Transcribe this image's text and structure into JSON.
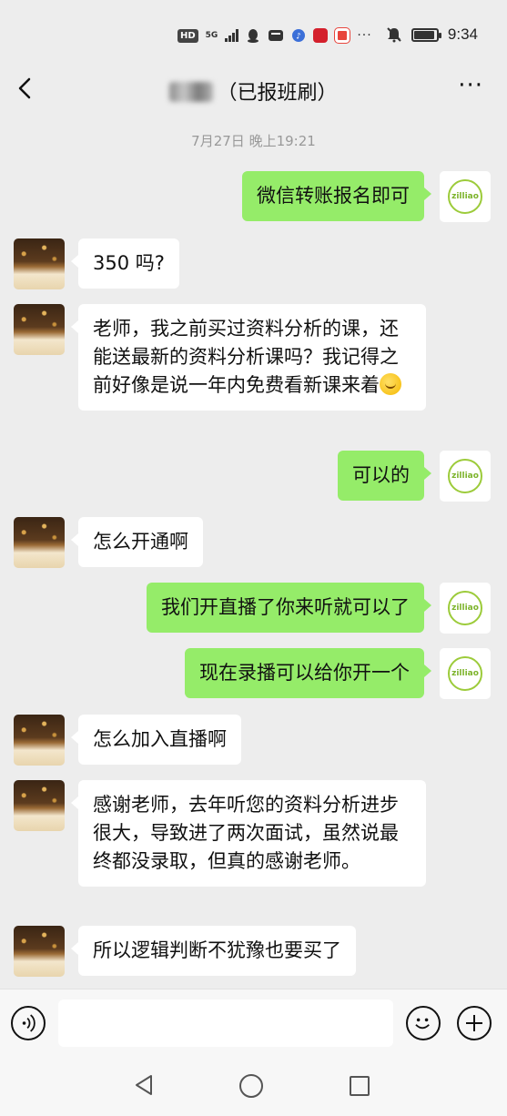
{
  "status_bar": {
    "network": "HD",
    "signal": "5G",
    "time": "9:34",
    "icons": [
      "hd-icon",
      "5g-signal-icon",
      "qq-icon",
      "wechat-status-icon",
      "music-icon",
      "app-icon",
      "app-icon-2",
      "more-dots-icon",
      "mute-icon",
      "battery-icon"
    ]
  },
  "header": {
    "title_suffix": "（已报班刷）",
    "more_label": "···"
  },
  "timestamp": "7月27日 晚上19:21",
  "self_avatar_text": "zilliao",
  "messages": [
    {
      "side": "right",
      "text": "微信转账报名即可"
    },
    {
      "side": "left",
      "text": "350 吗?"
    },
    {
      "side": "left",
      "text": "老师，我之前买过资料分析的课，还能送最新的资料分析课吗？我记得之前好像是说一年内免费看新课来着"
    },
    {
      "side": "right",
      "text": "可以的"
    },
    {
      "side": "left",
      "text": "怎么开通啊"
    },
    {
      "side": "right",
      "text": "我们开直播了你来听就可以了"
    },
    {
      "side": "right",
      "text": "现在录播可以给你开一个"
    },
    {
      "side": "left",
      "text": "怎么加入直播啊"
    },
    {
      "side": "left",
      "text": "感谢老师，去年听您的资料分析进步很大，导致进了两次面试，虽然说最终都没录取，但真的感谢老师。"
    },
    {
      "side": "left",
      "text": "所以逻辑判断不犹豫也要买了"
    }
  ],
  "input": {
    "value": "",
    "placeholder": ""
  },
  "colors": {
    "background": "#ededed",
    "bubble_self": "#95ec69",
    "bubble_other": "#ffffff"
  }
}
